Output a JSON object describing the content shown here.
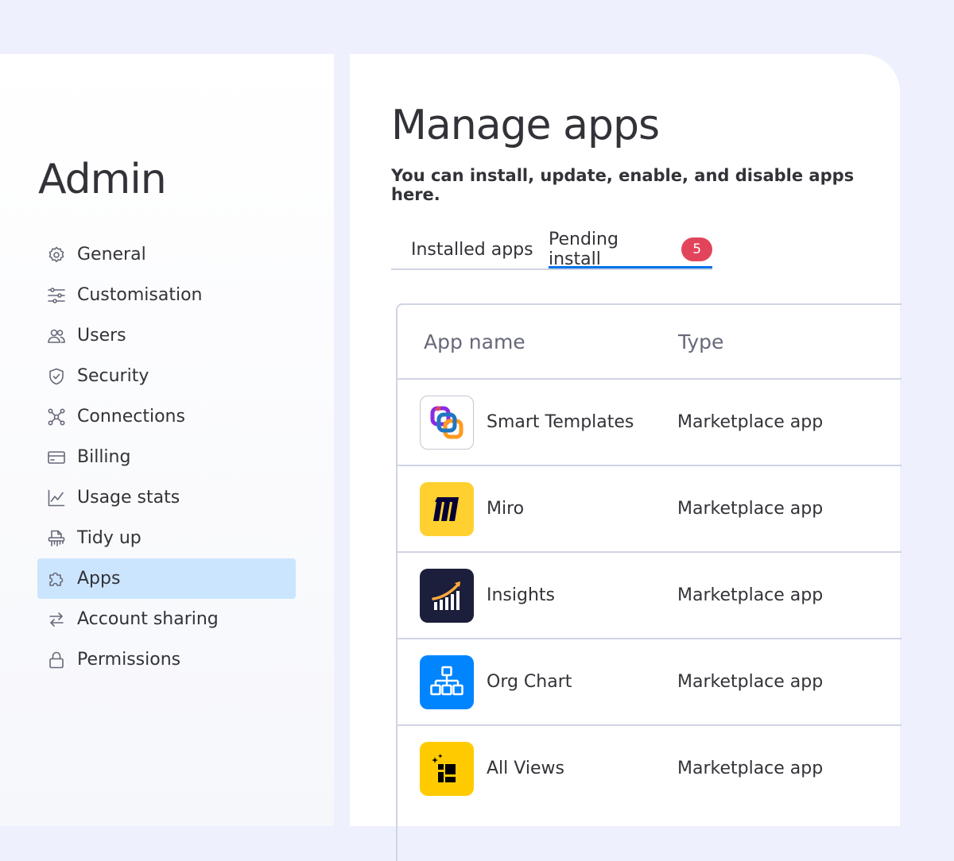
{
  "sidebar": {
    "title": "Admin",
    "items": [
      {
        "label": "General",
        "icon": "gear-icon"
      },
      {
        "label": "Customisation",
        "icon": "sliders-icon"
      },
      {
        "label": "Users",
        "icon": "users-icon"
      },
      {
        "label": "Security",
        "icon": "shield-icon"
      },
      {
        "label": "Connections",
        "icon": "connections-icon"
      },
      {
        "label": "Billing",
        "icon": "credit-card-icon"
      },
      {
        "label": "Usage stats",
        "icon": "chart-icon"
      },
      {
        "label": "Tidy up",
        "icon": "shredder-icon"
      },
      {
        "label": "Apps",
        "icon": "puzzle-icon",
        "active": true
      },
      {
        "label": "Account sharing",
        "icon": "arrows-swap-icon"
      },
      {
        "label": "Permissions",
        "icon": "lock-icon"
      }
    ]
  },
  "main": {
    "title": "Manage apps",
    "subtitle": "You can install, update, enable, and disable apps here.",
    "tabs": [
      {
        "label": "Installed apps"
      },
      {
        "label": "Pending install",
        "badge": "5",
        "active": true
      }
    ],
    "table": {
      "columns": [
        "App name",
        "Type"
      ],
      "rows": [
        {
          "name": "Smart Templates",
          "type": "Marketplace app",
          "icon": "smart-templates-logo"
        },
        {
          "name": "Miro",
          "type": "Marketplace app",
          "icon": "miro-logo"
        },
        {
          "name": "Insights",
          "type": "Marketplace app",
          "icon": "insights-logo"
        },
        {
          "name": "Org Chart",
          "type": "Marketplace app",
          "icon": "org-chart-logo"
        },
        {
          "name": "All Views",
          "type": "Marketplace app",
          "icon": "all-views-logo"
        }
      ]
    }
  },
  "colors": {
    "background": "#eef1fd",
    "active_nav": "#cce5ff",
    "tab_accent": "#0073ea",
    "badge": "#e2445c"
  }
}
